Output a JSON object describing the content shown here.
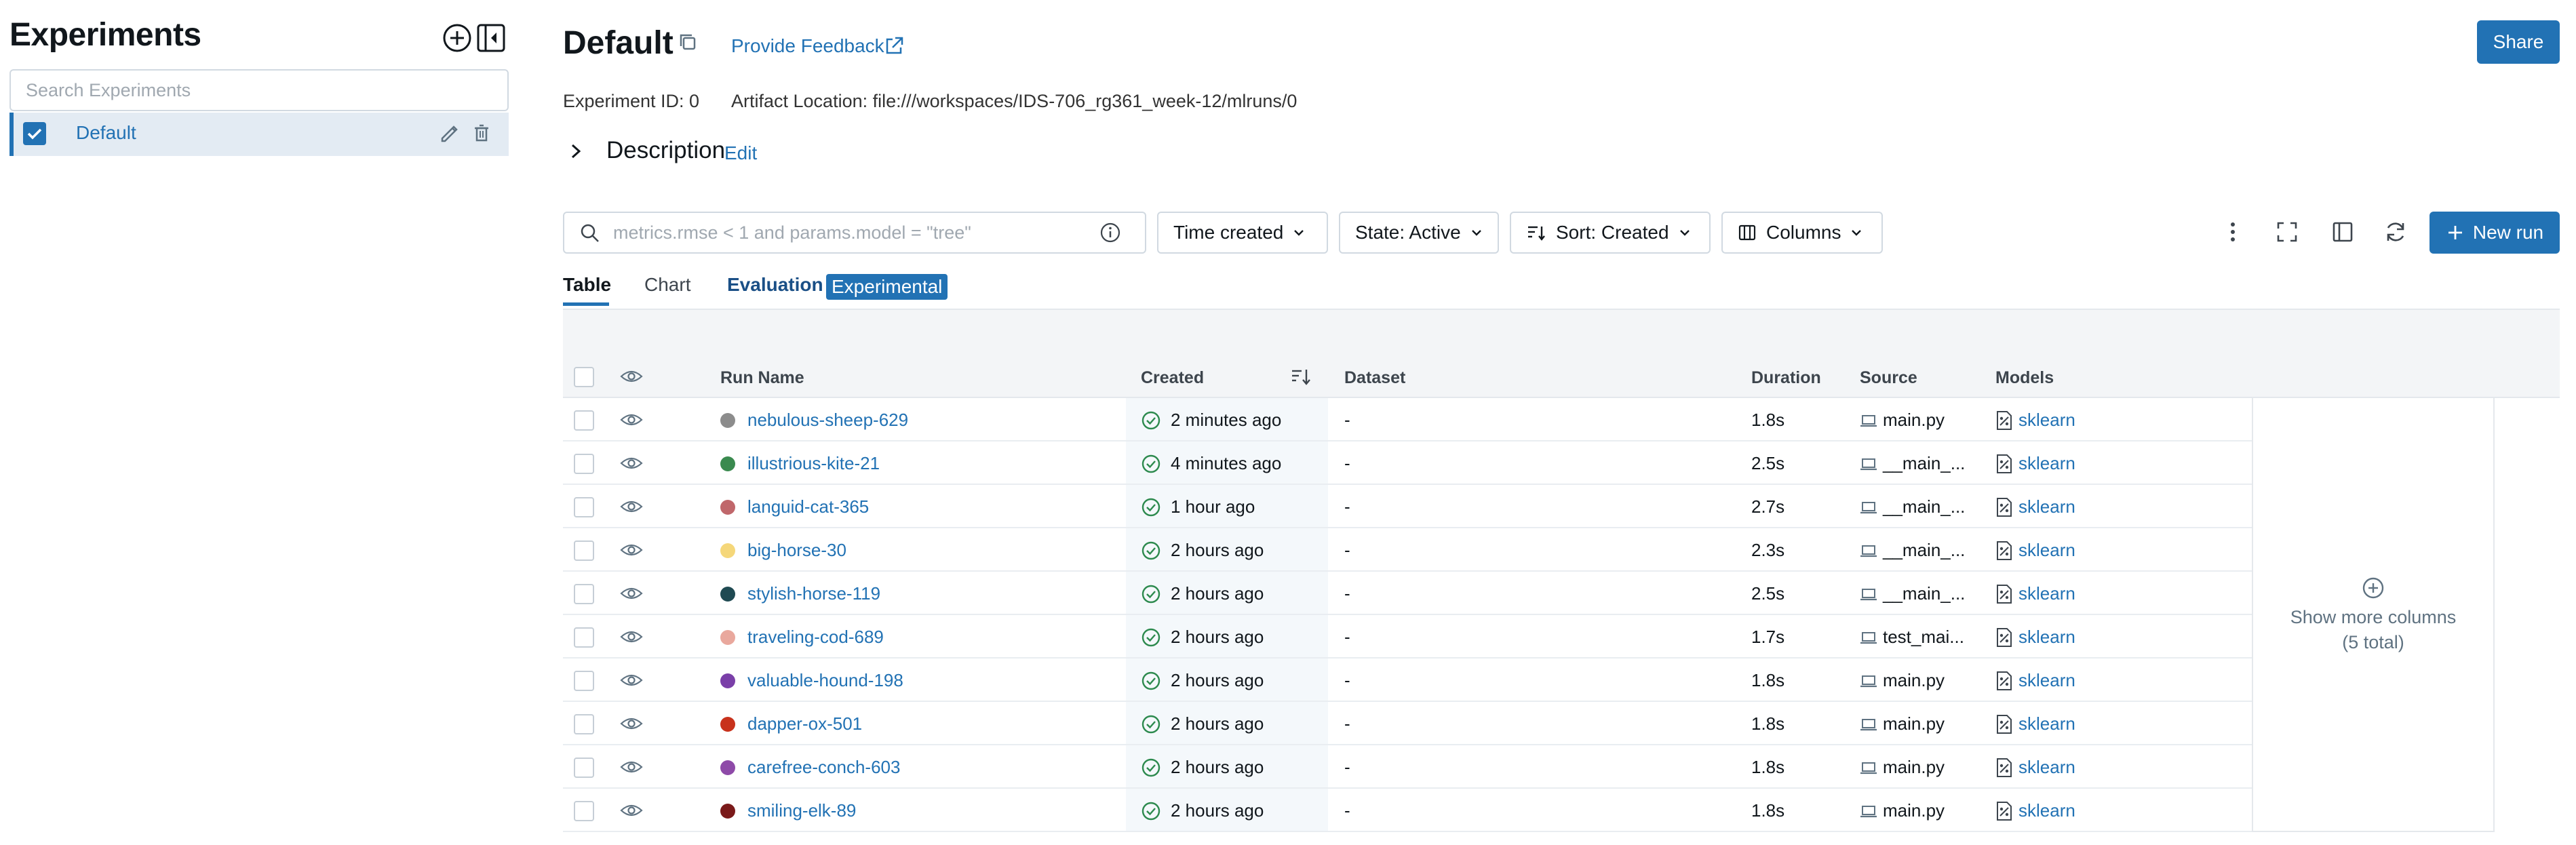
{
  "sidebar": {
    "title": "Experiments",
    "search_placeholder": "Search Experiments",
    "items": [
      {
        "name": "Default",
        "checked": true
      }
    ]
  },
  "header": {
    "title": "Default",
    "feedback_label": "Provide Feedback",
    "share_label": "Share",
    "experiment_id": "Experiment ID: 0",
    "artifact_location": "Artifact Location: file:///workspaces/IDS-706_rg361_week-12/mlruns/0",
    "description_label": "Description",
    "description_edit": "Edit"
  },
  "toolbar": {
    "search_placeholder": "metrics.rmse < 1 and params.model = \"tree\"",
    "time_created": "Time created",
    "state": "State: Active",
    "sort": "Sort: Created",
    "columns": "Columns",
    "new_run": "New run"
  },
  "tabs": {
    "table": "Table",
    "chart": "Chart",
    "evaluation": "Evaluation",
    "experimental": "Experimental"
  },
  "table": {
    "headers": {
      "run_name": "Run Name",
      "created": "Created",
      "dataset": "Dataset",
      "duration": "Duration",
      "source": "Source",
      "models": "Models"
    },
    "rows": [
      {
        "name": "nebulous-sheep-629",
        "color": "#8c8c8c",
        "created": "2 minutes ago",
        "dataset": "-",
        "duration": "1.8s",
        "source": "main.py",
        "model": "sklearn"
      },
      {
        "name": "illustrious-kite-21",
        "color": "#3a8a4f",
        "created": "4 minutes ago",
        "dataset": "-",
        "duration": "2.5s",
        "source": "__main_...",
        "model": "sklearn"
      },
      {
        "name": "languid-cat-365",
        "color": "#c0676b",
        "created": "1 hour ago",
        "dataset": "-",
        "duration": "2.7s",
        "source": "__main_...",
        "model": "sklearn"
      },
      {
        "name": "big-horse-30",
        "color": "#f5d77a",
        "created": "2 hours ago",
        "dataset": "-",
        "duration": "2.3s",
        "source": "__main_...",
        "model": "sklearn"
      },
      {
        "name": "stylish-horse-119",
        "color": "#1f4a52",
        "created": "2 hours ago",
        "dataset": "-",
        "duration": "2.5s",
        "source": "__main_...",
        "model": "sklearn"
      },
      {
        "name": "traveling-cod-689",
        "color": "#e9a89d",
        "created": "2 hours ago",
        "dataset": "-",
        "duration": "1.7s",
        "source": "test_mai...",
        "model": "sklearn"
      },
      {
        "name": "valuable-hound-198",
        "color": "#7a3fa8",
        "created": "2 hours ago",
        "dataset": "-",
        "duration": "1.8s",
        "source": "main.py",
        "model": "sklearn"
      },
      {
        "name": "dapper-ox-501",
        "color": "#c8321c",
        "created": "2 hours ago",
        "dataset": "-",
        "duration": "1.8s",
        "source": "main.py",
        "model": "sklearn"
      },
      {
        "name": "carefree-conch-603",
        "color": "#8e4aa8",
        "created": "2 hours ago",
        "dataset": "-",
        "duration": "1.8s",
        "source": "main.py",
        "model": "sklearn"
      },
      {
        "name": "smiling-elk-89",
        "color": "#7a1a1a",
        "created": "2 hours ago",
        "dataset": "-",
        "duration": "1.8s",
        "source": "main.py",
        "model": "sklearn"
      }
    ],
    "more_columns_label": "Show more columns",
    "more_columns_count": "(5 total)"
  },
  "colors": {
    "accent": "#2272b4",
    "status_ok": "#2d8a4e"
  }
}
